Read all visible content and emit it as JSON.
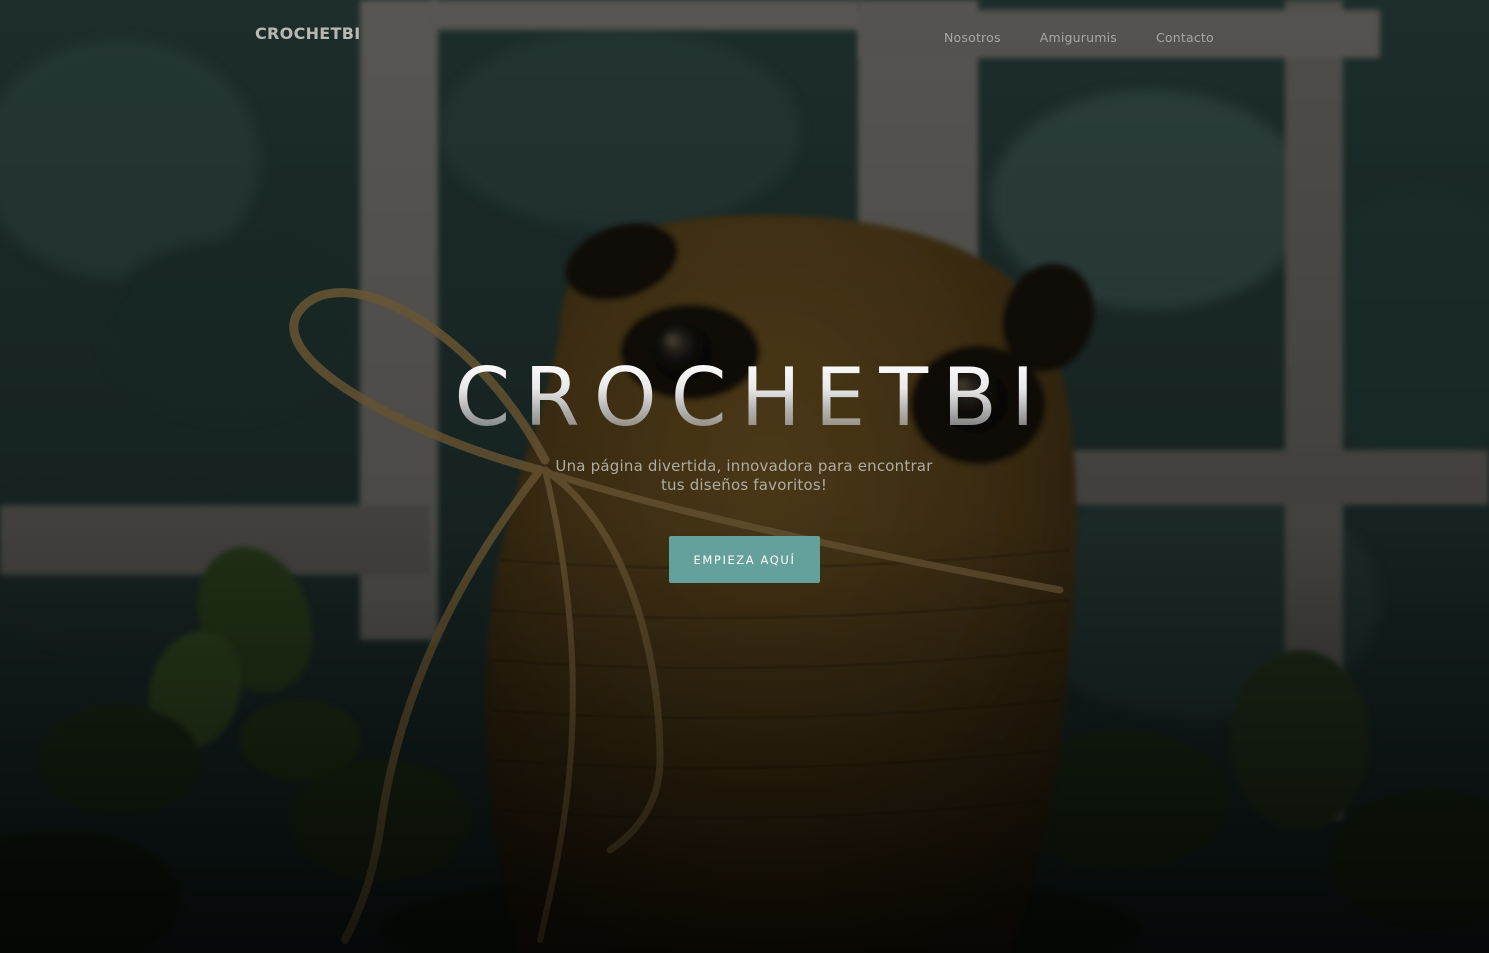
{
  "nav": {
    "brand": "CROCHETBI",
    "links": [
      {
        "label": "Nosotros"
      },
      {
        "label": "Amigurumis"
      },
      {
        "label": "Contacto"
      }
    ]
  },
  "masthead": {
    "title": "CROCHETBI",
    "subtitle": "Una página divertida, innovadora para encontrar tus diseños favoritos!",
    "cta_label": "EMPIEZA AQUÍ"
  },
  "colors": {
    "accent": "#64a19d",
    "nav_text": "#a6a7a2",
    "overlay": "#000000"
  }
}
